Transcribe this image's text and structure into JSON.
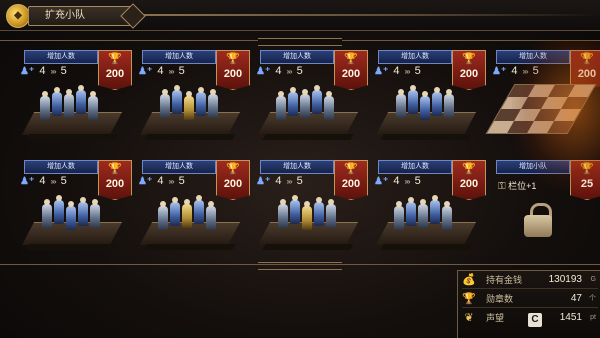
{
  "header": {
    "icon": "gem-coin-icon",
    "title": "扩充小队"
  },
  "cards": [
    {
      "header": "增加人数",
      "from": "4",
      "arrows": "›››",
      "to": "5",
      "cost": "200",
      "variant": "silver"
    },
    {
      "header": "增加人数",
      "from": "4",
      "arrows": "›››",
      "to": "5",
      "cost": "200",
      "variant": "gold"
    },
    {
      "header": "增加人数",
      "from": "4",
      "arrows": "›››",
      "to": "5",
      "cost": "200",
      "variant": "silver"
    },
    {
      "header": "增加人数",
      "from": "4",
      "arrows": "›››",
      "to": "5",
      "cost": "200",
      "variant": "blue"
    },
    {
      "header": "增加人数",
      "from": "4",
      "arrows": "›››",
      "to": "5",
      "cost": "200",
      "variant": "checker"
    },
    {
      "header": "增加人数",
      "from": "4",
      "arrows": "›››",
      "to": "5",
      "cost": "200",
      "variant": "blue"
    },
    {
      "header": "增加人数",
      "from": "4",
      "arrows": "›››",
      "to": "5",
      "cost": "200",
      "variant": "gold"
    },
    {
      "header": "增加人数",
      "from": "4",
      "arrows": "›››",
      "to": "5",
      "cost": "200",
      "variant": "gold"
    },
    {
      "header": "增加人数",
      "from": "4",
      "arrows": "›››",
      "to": "5",
      "cost": "200",
      "variant": "silver"
    },
    {
      "header": "增加小队",
      "slot_label": "栏位+1",
      "cost": "25",
      "variant": "lock"
    }
  ],
  "resources": {
    "gold": {
      "label": "持有金钱",
      "value": "130193",
      "unit": "G"
    },
    "medals": {
      "label": "勋章数",
      "value": "47",
      "unit": "个"
    },
    "fame": {
      "label": "声望",
      "value": "1451",
      "unit": "pt",
      "rank": "C"
    }
  },
  "colors": {
    "accent_gold": "#c0975a",
    "cost_red": "#9e2a1e",
    "header_blue": "#2b3f78"
  }
}
